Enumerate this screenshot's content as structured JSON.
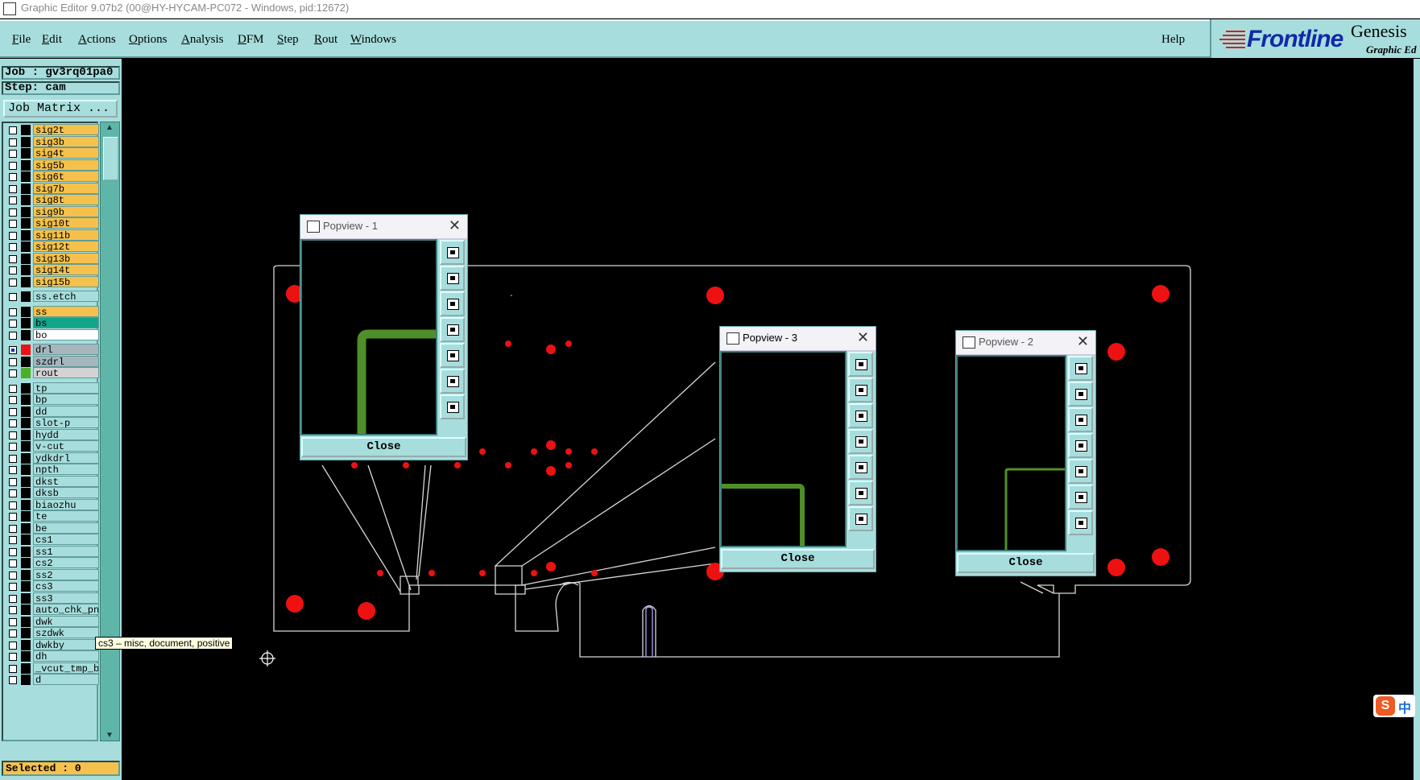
{
  "window": {
    "title": "Graphic Editor 9.07b2 (00@HY-HYCAM-PC072 - Windows, pid:12672)"
  },
  "menubar": {
    "items": [
      {
        "label": "File",
        "u": "F",
        "rest": "ile"
      },
      {
        "label": "Edit",
        "u": "E",
        "rest": "dit"
      },
      {
        "label": "Actions",
        "u": "A",
        "rest": "ctions"
      },
      {
        "label": "Options",
        "u": "O",
        "rest": "ptions"
      },
      {
        "label": "Analysis",
        "u": "A",
        "rest": "nalysis"
      },
      {
        "label": "DFM",
        "u": "D",
        "rest": "FM"
      },
      {
        "label": "Step",
        "u": "S",
        "rest": "tep"
      },
      {
        "label": "Rout",
        "u": "R",
        "rest": "out"
      },
      {
        "label": "Windows",
        "u": "W",
        "rest": "indows"
      }
    ],
    "help": "Help"
  },
  "logo": {
    "brand": "Frontline",
    "product": "Genesis",
    "subtitle": "Graphic Ed"
  },
  "panel": {
    "job": "Job : gv3rq01pa0",
    "step": "Step: cam",
    "job_matrix": "Job Matrix ...",
    "selected": "Selected : 0"
  },
  "layers": [
    {
      "name": "sig2t",
      "color": "#f5c14c",
      "swatch": "#000000"
    },
    {
      "name": "sig3b",
      "color": "#f5c14c",
      "swatch": "#000000"
    },
    {
      "name": "sig4t",
      "color": "#f5c14c",
      "swatch": "#000000"
    },
    {
      "name": "sig5b",
      "color": "#f5c14c",
      "swatch": "#000000"
    },
    {
      "name": "sig6t",
      "color": "#f5c14c",
      "swatch": "#000000"
    },
    {
      "name": "sig7b",
      "color": "#f5c14c",
      "swatch": "#000000"
    },
    {
      "name": "sig8t",
      "color": "#f5c14c",
      "swatch": "#000000"
    },
    {
      "name": "sig9b",
      "color": "#f5c14c",
      "swatch": "#000000"
    },
    {
      "name": "sig10t",
      "color": "#f5c14c",
      "swatch": "#000000"
    },
    {
      "name": "sig11b",
      "color": "#f5c14c",
      "swatch": "#000000"
    },
    {
      "name": "sig12t",
      "color": "#f5c14c",
      "swatch": "#000000"
    },
    {
      "name": "sig13b",
      "color": "#f5c14c",
      "swatch": "#000000"
    },
    {
      "name": "sig14t",
      "color": "#f5c14c",
      "swatch": "#000000"
    },
    {
      "name": "sig15b",
      "color": "#f5c14c",
      "swatch": "#000000"
    },
    {
      "name": "ss.etch",
      "color": "#a7dedd",
      "swatch": "#000000",
      "gap": true
    },
    {
      "name": "ss",
      "color": "#f5c14c",
      "swatch": "#000000",
      "gap": true
    },
    {
      "name": "bs",
      "color": "#12a58a",
      "swatch": "#000000"
    },
    {
      "name": "bo",
      "color": "#ffffff",
      "swatch": "#000000"
    },
    {
      "name": "drl",
      "color": "#a7b6bd",
      "swatch": "#ee1111",
      "gap": true,
      "checked": true
    },
    {
      "name": "szdrl",
      "color": "#a7b6bd",
      "swatch": "#000000"
    },
    {
      "name": "rout",
      "color": "#d3d3d3",
      "swatch": "#4caf27"
    },
    {
      "name": "tp",
      "color": "#a7dedd",
      "swatch": "#000000",
      "gap": true
    },
    {
      "name": "bp",
      "color": "#a7dedd",
      "swatch": "#000000"
    },
    {
      "name": "dd",
      "color": "#a7dedd",
      "swatch": "#000000"
    },
    {
      "name": "slot-p",
      "color": "#a7dedd",
      "swatch": "#000000"
    },
    {
      "name": "hydd",
      "color": "#a7dedd",
      "swatch": "#000000"
    },
    {
      "name": "v-cut",
      "color": "#a7dedd",
      "swatch": "#000000"
    },
    {
      "name": "ydkdrl",
      "color": "#a7dedd",
      "swatch": "#000000"
    },
    {
      "name": "npth",
      "color": "#a7dedd",
      "swatch": "#000000"
    },
    {
      "name": "dkst",
      "color": "#a7dedd",
      "swatch": "#000000"
    },
    {
      "name": "dksb",
      "color": "#a7dedd",
      "swatch": "#000000"
    },
    {
      "name": "biaozhu",
      "color": "#a7dedd",
      "swatch": "#000000"
    },
    {
      "name": "te",
      "color": "#a7dedd",
      "swatch": "#000000"
    },
    {
      "name": "be",
      "color": "#a7dedd",
      "swatch": "#000000"
    },
    {
      "name": "cs1",
      "color": "#a7dedd",
      "swatch": "#000000"
    },
    {
      "name": "ss1",
      "color": "#a7dedd",
      "swatch": "#000000"
    },
    {
      "name": "cs2",
      "color": "#a7dedd",
      "swatch": "#000000"
    },
    {
      "name": "ss2",
      "color": "#a7dedd",
      "swatch": "#000000"
    },
    {
      "name": "cs3",
      "color": "#a7dedd",
      "swatch": "#000000"
    },
    {
      "name": "ss3",
      "color": "#a7dedd",
      "swatch": "#000000"
    },
    {
      "name": "auto_chk_pn",
      "color": "#a7dedd",
      "swatch": "#000000"
    },
    {
      "name": "dwk",
      "color": "#a7dedd",
      "swatch": "#000000"
    },
    {
      "name": "szdwk",
      "color": "#a7dedd",
      "swatch": "#000000"
    },
    {
      "name": "dwkby",
      "color": "#a7dedd",
      "swatch": "#000000"
    },
    {
      "name": "dh",
      "color": "#a7dedd",
      "swatch": "#000000"
    },
    {
      "name": "_vcut_tmp_ba",
      "color": "#a7dedd",
      "swatch": "#000000"
    },
    {
      "name": "d",
      "color": "#a7dedd",
      "swatch": "#000000"
    }
  ],
  "tooltip": "cs3 – misc, document, positive",
  "popviews": [
    {
      "title": "Popview - 1",
      "close": "Close"
    },
    {
      "title": "Popview - 3",
      "close": "Close"
    },
    {
      "title": "Popview - 2",
      "close": "Close"
    }
  ],
  "colors": {
    "panel": "#a7dedd",
    "drill": "#ee1111",
    "rout": "#4e8f2a",
    "outline": "#d8d8d8"
  }
}
